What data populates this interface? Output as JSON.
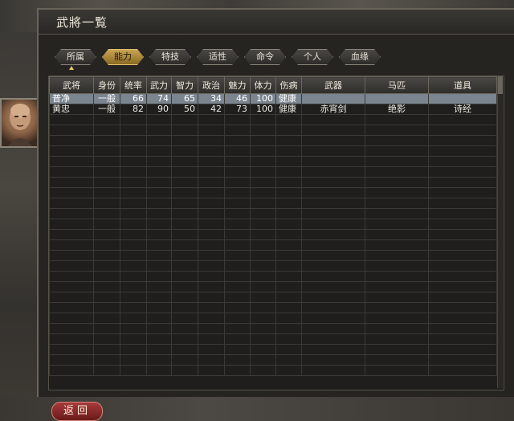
{
  "window": {
    "title": "武將一覧"
  },
  "tabs": [
    {
      "label": "所属",
      "active": false
    },
    {
      "label": "能力",
      "active": true
    },
    {
      "label": "特技",
      "active": false
    },
    {
      "label": "适性",
      "active": false
    },
    {
      "label": "命令",
      "active": false
    },
    {
      "label": "个人",
      "active": false
    },
    {
      "label": "血缘",
      "active": false
    }
  ],
  "table": {
    "headers": [
      "武将",
      "身份",
      "统率",
      "武力",
      "智力",
      "政治",
      "魅力",
      "体力",
      "伤病",
      "武器",
      "马匹",
      "道具"
    ],
    "rows": [
      [
        "普净",
        "一般",
        "66",
        "74",
        "65",
        "34",
        "46",
        "100",
        "健康",
        "",
        "",
        ""
      ],
      [
        "黄忠",
        "一般",
        "82",
        "90",
        "50",
        "42",
        "73",
        "100",
        "健康",
        "赤宵剑",
        "绝影",
        "诗经"
      ]
    ],
    "empty_rows": 25,
    "selected_row": 0
  },
  "footer": {
    "back_label": "返回"
  },
  "colors": {
    "accent": "#c9a452",
    "selection": "#7a8590",
    "back_button": "#a83a3a"
  },
  "icons": {
    "portrait": "general-portrait-icon",
    "sort": "sort-ascending-icon"
  }
}
